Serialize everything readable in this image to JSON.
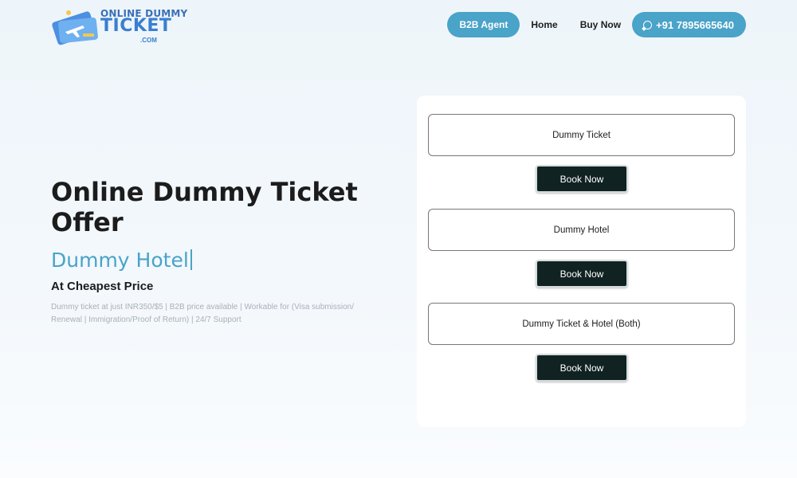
{
  "header": {
    "logo": {
      "line1": "ONLINE DUMMY",
      "line2": "TICKET",
      "line3": ".COM"
    },
    "nav": {
      "b2b_label": "B2B Agent",
      "home_label": "Home",
      "buy_label": "Buy Now",
      "phone_label": "+91 7895665640",
      "phone_icon": "whatsapp-icon"
    }
  },
  "hero": {
    "title": "Online Dummy Ticket Offer",
    "typed_text": "Dummy Hotel",
    "tagline": "At Cheapest Price",
    "description": "Dummy ticket at just INR350/$5 | B2B price available | Workable for (Visa submission/ Renewal | Immigration/Proof of Return) | 24/7 Support"
  },
  "booking": {
    "options": [
      {
        "label": "Dummy Ticket",
        "button": "Book Now"
      },
      {
        "label": "Dummy Hotel",
        "button": "Book Now"
      },
      {
        "label": "Dummy Ticket & Hotel (Both)",
        "button": "Book Now"
      }
    ]
  },
  "colors": {
    "accent": "#4aa3c8",
    "button_dark": "#102222",
    "logo_blue": "#3a7fd0"
  }
}
